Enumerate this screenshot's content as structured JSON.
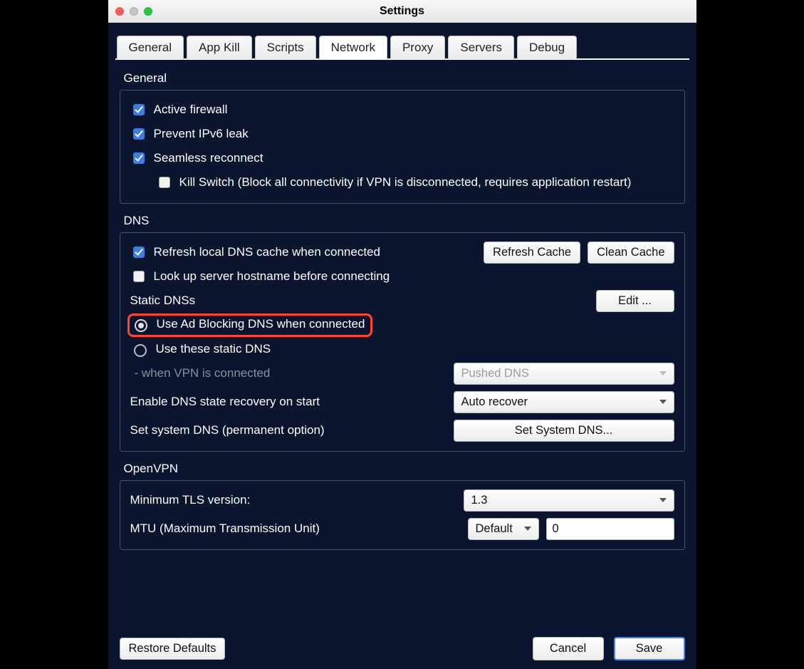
{
  "window": {
    "title": "Settings"
  },
  "tabs": [
    "General",
    "App Kill",
    "Scripts",
    "Network",
    "Proxy",
    "Servers",
    "Debug"
  ],
  "active_tab": "Network",
  "sections": {
    "general": {
      "title": "General",
      "active_firewall": {
        "label": "Active firewall",
        "checked": true
      },
      "prevent_ipv6": {
        "label": "Prevent IPv6 leak",
        "checked": true
      },
      "seamless": {
        "label": "Seamless reconnect",
        "checked": true
      },
      "kill_switch": {
        "label": "Kill Switch (Block all connectivity if VPN is disconnected, requires application restart)",
        "checked": false
      }
    },
    "dns": {
      "title": "DNS",
      "refresh_cache_chk": {
        "label": "Refresh local DNS cache when connected",
        "checked": true
      },
      "lookup_hostname": {
        "label": "Look up server hostname before connecting",
        "checked": false
      },
      "static_dnss_label": "Static DNSs",
      "edit_btn": "Edit ...",
      "refresh_btn": "Refresh Cache",
      "clean_btn": "Clean Cache",
      "radio_adblock": "Use Ad Blocking DNS when connected",
      "radio_static": "Use these static DNS",
      "radio_choice": "adblock",
      "when_connected_lbl": " - when VPN is connected",
      "pushed_dns": "Pushed DNS",
      "recovery_lbl": "Enable DNS state recovery on start",
      "recovery_val": "Auto recover",
      "set_system_lbl": "Set system DNS (permanent option)",
      "set_system_btn": "Set System DNS..."
    },
    "openvpn": {
      "title": "OpenVPN",
      "tls_lbl": "Minimum TLS version:",
      "tls_val": "1.3",
      "mtu_lbl": "MTU (Maximum Transmission Unit)",
      "mtu_sel": "Default",
      "mtu_val": "0"
    }
  },
  "footer": {
    "restore": "Restore Defaults",
    "cancel": "Cancel",
    "save": "Save"
  }
}
